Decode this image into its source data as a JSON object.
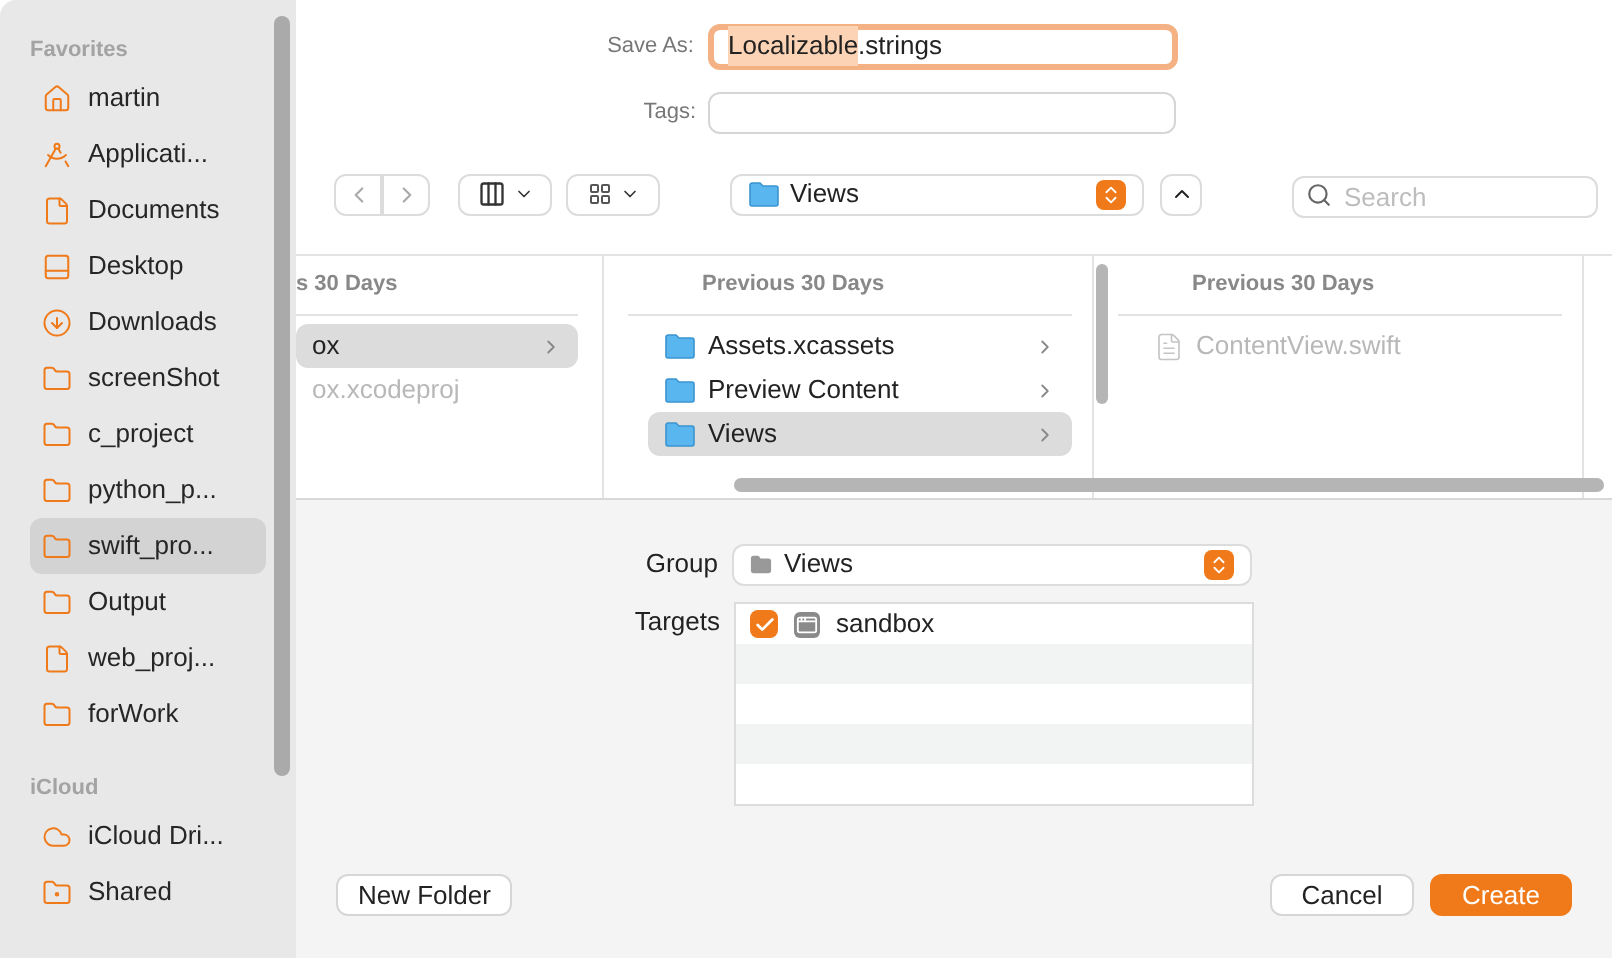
{
  "sidebar": {
    "sections": [
      {
        "title": "Favorites",
        "items": [
          {
            "label": "martin",
            "kind": "home",
            "selected": false
          },
          {
            "label": "Applicati...",
            "kind": "apps",
            "selected": false
          },
          {
            "label": "Documents",
            "kind": "document",
            "selected": false
          },
          {
            "label": "Desktop",
            "kind": "desktop",
            "selected": false
          },
          {
            "label": "Downloads",
            "kind": "download",
            "selected": false
          },
          {
            "label": "screenShot",
            "kind": "folder",
            "selected": false
          },
          {
            "label": "c_project",
            "kind": "folder",
            "selected": false
          },
          {
            "label": "python_p...",
            "kind": "folder",
            "selected": false
          },
          {
            "label": "swift_pro...",
            "kind": "folder",
            "selected": true
          },
          {
            "label": "Output",
            "kind": "folder",
            "selected": false
          },
          {
            "label": "web_proj...",
            "kind": "document",
            "selected": false
          },
          {
            "label": "forWork",
            "kind": "folder",
            "selected": false
          }
        ]
      },
      {
        "title": "iCloud",
        "items": [
          {
            "label": "iCloud Dri...",
            "kind": "cloud",
            "selected": false
          },
          {
            "label": "Shared",
            "kind": "shared",
            "selected": false
          }
        ]
      }
    ]
  },
  "save_as": {
    "label": "Save As:",
    "value_selected": "Localizable",
    "value_rest": ".strings"
  },
  "tags": {
    "label": "Tags:"
  },
  "location": {
    "value": "Views"
  },
  "search": {
    "placeholder": "Search"
  },
  "columns": [
    {
      "header": "s 30 Days",
      "items": [
        {
          "label": "ox",
          "kind": "none",
          "selected": true,
          "disabled": false,
          "has_children": true
        },
        {
          "label": "ox.xcodeproj",
          "kind": "none",
          "selected": false,
          "disabled": true,
          "has_children": false
        }
      ]
    },
    {
      "header": "Previous 30 Days",
      "items": [
        {
          "label": "Assets.xcassets",
          "kind": "folder",
          "selected": false,
          "disabled": false,
          "has_children": true
        },
        {
          "label": "Preview Content",
          "kind": "folder",
          "selected": false,
          "disabled": false,
          "has_children": true
        },
        {
          "label": "Views",
          "kind": "folder",
          "selected": true,
          "disabled": false,
          "has_children": true
        }
      ]
    },
    {
      "header": "Previous 30 Days",
      "items": [
        {
          "label": "ContentView.swift",
          "kind": "file",
          "selected": false,
          "disabled": true,
          "has_children": false
        }
      ]
    }
  ],
  "group": {
    "label": "Group",
    "value": "Views"
  },
  "targets": {
    "label": "Targets",
    "items": [
      {
        "label": "sandbox",
        "checked": true
      }
    ]
  },
  "buttons": [
    {
      "label": "New Folder",
      "kind": "secondary"
    },
    {
      "label": "Cancel",
      "kind": "secondary"
    },
    {
      "label": "Create",
      "kind": "primary"
    }
  ]
}
